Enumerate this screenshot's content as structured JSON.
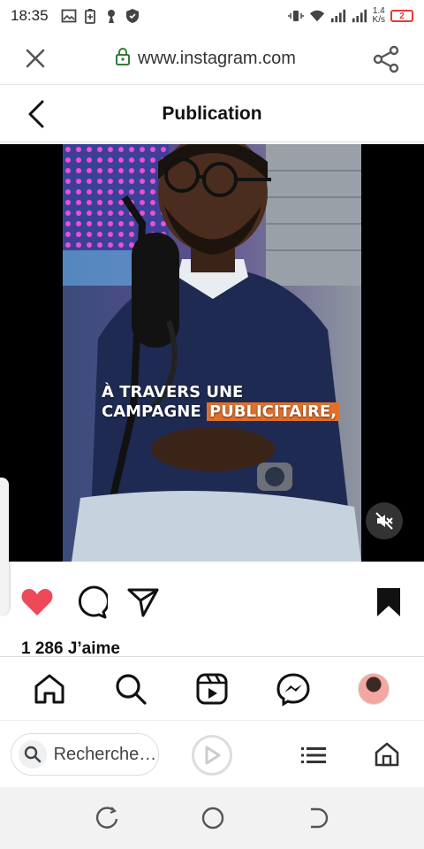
{
  "status_bar": {
    "time": "18:35",
    "net_speed_value": "1.4",
    "net_speed_unit": "K/s",
    "battery": "2"
  },
  "url_bar": {
    "url": "www.instagram.com",
    "lock_color": "#2e7d32"
  },
  "header": {
    "title": "Publication"
  },
  "video": {
    "caption_line1": "À TRAVERS UNE",
    "caption_line2_plain": "CAMPAGNE",
    "caption_line2_highlight": "PUBLICITAIRE,",
    "highlight_color": "#e0712b"
  },
  "post": {
    "likes": "1 286 J’aime",
    "like_color": "#ed4956"
  },
  "browser_bar": {
    "search_placeholder": "Rechercher..."
  },
  "icons": {
    "status_left": [
      "gallery-icon",
      "battery-saver-icon",
      "keyhole-icon",
      "shield-icon"
    ],
    "status_right": [
      "vibrate-icon",
      "wifi-icon",
      "signal-icon",
      "signal-icon"
    ],
    "ig_nav": [
      "home-icon",
      "search-icon",
      "reels-icon",
      "messenger-icon",
      "profile-avatar"
    ],
    "browser": [
      "search-icon",
      "play-icon",
      "list-icon",
      "home-icon"
    ],
    "android": [
      "recent-apps-icon",
      "home-circle-icon",
      "back-icon"
    ]
  }
}
